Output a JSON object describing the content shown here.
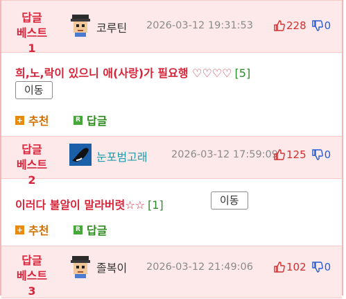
{
  "comments": [
    {
      "best_label": "답글\n베스트1",
      "nick": "코루틴",
      "time": "2026-03-12 19:31:53",
      "up": "228",
      "down": "0",
      "text": "희,노,락이 있으니 애(사랑)가 필요행 ♡♡♡♡",
      "reply_count": "[5]",
      "move_label": "이동",
      "recommend_label": "추천",
      "reply_label": "답글",
      "avatar_icon": "pixel-face-avatar-icon"
    },
    {
      "best_label": "답글\n베스트2",
      "nick": "눈포범고래",
      "time": "2026-03-12 17:59:09",
      "up": "125",
      "down": "0",
      "text": "이러다 불알이 말라버렷☆☆",
      "reply_count": "[1]",
      "move_label": "이동",
      "recommend_label": "추천",
      "reply_label": "답글",
      "avatar_icon": "orca-avatar-icon"
    },
    {
      "best_label": "답글\n베스트3",
      "nick": "졸복이",
      "time": "2026-03-12 21:49:06",
      "up": "102",
      "down": "0",
      "avatar_icon": "pixel-face-avatar-icon"
    }
  ],
  "colors": {
    "accent_red": "#d8233b",
    "header_bg": "#fde9e9",
    "border": "#f4b6b8"
  }
}
